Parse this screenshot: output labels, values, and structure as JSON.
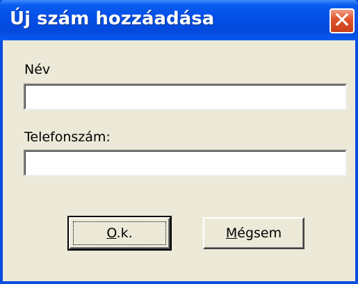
{
  "dialog": {
    "title": "Új szám hozzáadása",
    "close_icon": "close-icon"
  },
  "form": {
    "name_label": "Név",
    "name_value": "",
    "phone_label": "Telefonszám:",
    "phone_value": ""
  },
  "buttons": {
    "ok_mnemonic": "O",
    "ok_rest": ".k.",
    "cancel_mnemonic": "M",
    "cancel_rest": "égsem"
  },
  "colors": {
    "title_bar": "#0450E8",
    "dialog_background": "#ECE9D8",
    "close_button": "#E1542E"
  }
}
